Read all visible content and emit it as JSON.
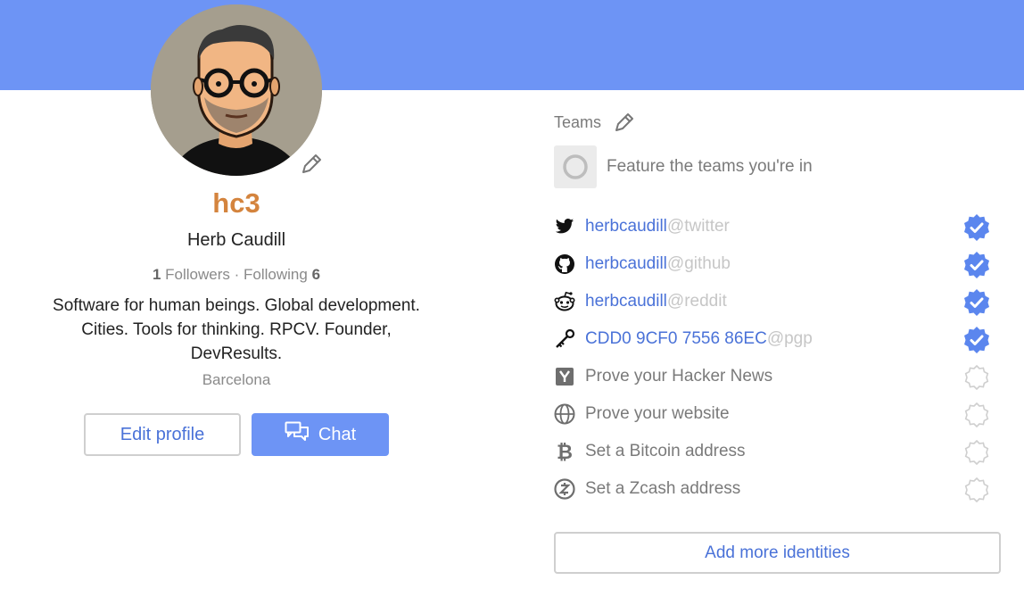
{
  "profile": {
    "username": "hc3",
    "full_name": "Herb Caudill",
    "followers_count": "1",
    "followers_label": "Followers",
    "separator": "·",
    "following_label": "Following",
    "following_count": "6",
    "bio": "Software for human beings. Global development. Cities. Tools for thinking. RPCV. Founder, DevResults.",
    "location": "Barcelona"
  },
  "actions": {
    "edit_profile_label": "Edit profile",
    "chat_label": "Chat",
    "add_identities_label": "Add more identities"
  },
  "teams": {
    "label": "Teams",
    "feature_prompt": "Feature the teams you're in"
  },
  "identities": [
    {
      "icon": "twitter-icon",
      "name": "herbcaudill",
      "service": "@twitter",
      "verified": true
    },
    {
      "icon": "github-icon",
      "name": "herbcaudill",
      "service": "@github",
      "verified": true
    },
    {
      "icon": "reddit-icon",
      "name": "herbcaudill",
      "service": "@reddit",
      "verified": true
    },
    {
      "icon": "key-icon",
      "name": "CDD0 9CF0 7556 86EC",
      "service": "@pgp",
      "verified": true
    }
  ],
  "prompts": [
    {
      "icon": "hacker-news-icon",
      "text": "Prove your Hacker News",
      "verified": false
    },
    {
      "icon": "globe-icon",
      "text": "Prove your website",
      "verified": false
    },
    {
      "icon": "bitcoin-icon",
      "text": "Set a Bitcoin address",
      "verified": false
    },
    {
      "icon": "zcash-icon",
      "text": "Set a Zcash address",
      "verified": false
    }
  ],
  "colors": {
    "banner": "#6d94f5",
    "username": "#d4843e",
    "link": "#4a72d8",
    "verified_badge": "#5b86ee"
  }
}
